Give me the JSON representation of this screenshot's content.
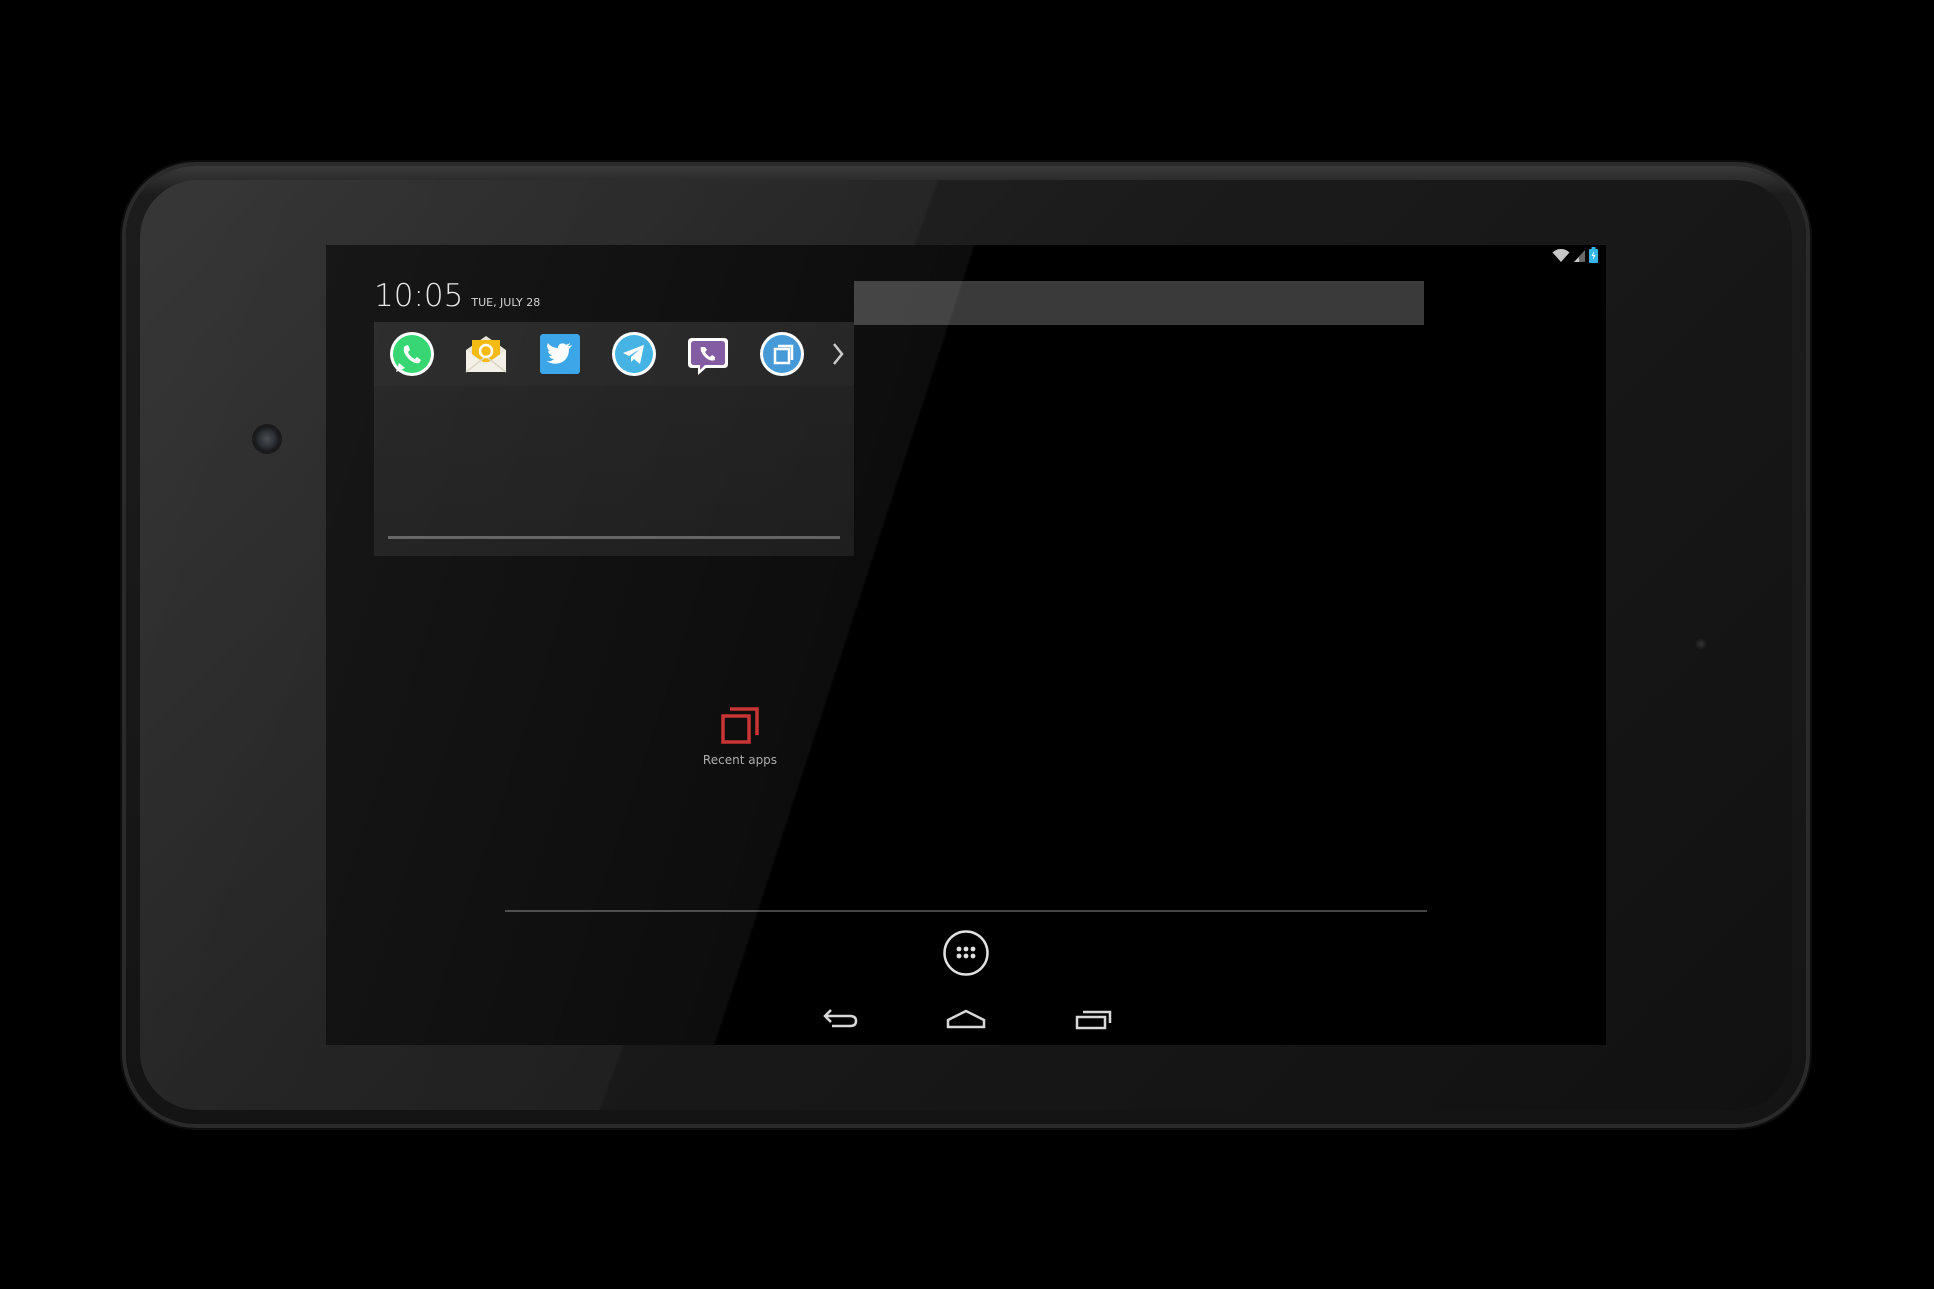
{
  "status_bar": {
    "icons": [
      "wifi-icon",
      "signal-icon",
      "battery-charging-icon"
    ],
    "accent_color": "#33b5e5"
  },
  "widget": {
    "time": "10:05",
    "date": "TUE, JULY 28",
    "apps": [
      {
        "name": "WhatsApp",
        "icon": "whatsapp-icon",
        "color": "#25d366"
      },
      {
        "name": "Email",
        "icon": "email-icon",
        "color": "#f4b400"
      },
      {
        "name": "Twitter",
        "icon": "twitter-icon",
        "color": "#2d9fe6"
      },
      {
        "name": "Telegram",
        "icon": "telegram-icon",
        "color": "#37aee2"
      },
      {
        "name": "Viber",
        "icon": "viber-icon",
        "color": "#7b519d"
      },
      {
        "name": "Recent apps",
        "icon": "recent-apps-icon",
        "color": "#3a93d6"
      }
    ],
    "more_icon": "chevron-right-icon"
  },
  "center": {
    "recent_label": "Recent apps",
    "recent_color": "#c62828"
  },
  "dock": {
    "all_apps_icon": "app-drawer-icon"
  },
  "nav": {
    "back_icon": "back-icon",
    "home_icon": "home-icon",
    "recents_icon": "recents-icon"
  }
}
